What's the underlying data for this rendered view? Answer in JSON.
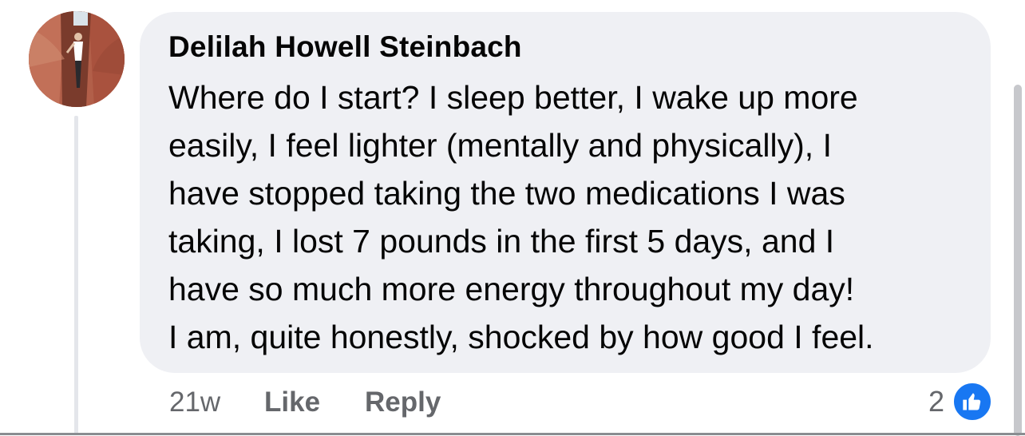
{
  "comment": {
    "author": "Delilah Howell Steinbach",
    "lines": [
      "Where do I start?  I sleep better, I wake up more",
      "easily, I feel lighter (mentally and physically), I",
      "have stopped taking the two medications I was",
      "taking, I lost 7 pounds in the first 5 days, and I",
      "have so much more energy throughout my day!",
      "I am, quite honestly, shocked by how good I feel."
    ],
    "timestamp": "21w",
    "like_label": "Like",
    "reply_label": "Reply",
    "reaction_count": "2",
    "reaction_icon": "thumbs-up-icon"
  },
  "colors": {
    "bubble": "#eff0f4",
    "text": "#050505",
    "secondary_text": "#65676b",
    "like_badge": "#1877f2",
    "thread_line": "#e4e6eb"
  }
}
